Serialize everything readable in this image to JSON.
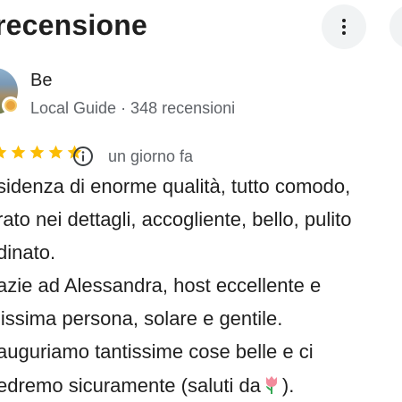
{
  "header": {
    "title": "recensione",
    "more_icon": "more-vert-icon"
  },
  "reviewer": {
    "name": "Be",
    "meta": "Local Guide · 348 recensioni",
    "badge_icon": "local-guide-badge-icon"
  },
  "review": {
    "rating": 5,
    "rating_max": 5,
    "star_color": "#fbbc04",
    "time": "un giorno fa",
    "info_icon": "info-icon",
    "lines": [
      "sidenza di enorme qualità, tutto comodo,",
      "rato nei dettagli, accogliente, bello, pulito",
      "dinato.",
      "azie ad Alessandra, host eccellente e",
      "lissima persona, solare e gentile.",
      "auguriamo tantissime cose belle e ci",
      "edremo sicuramente (saluti da",
      ")."
    ],
    "emoji": "tulip-icon"
  },
  "colors": {
    "title": "#1f1f1f",
    "secondary_text": "#5f6368",
    "button_bg": "#f1f3f4"
  }
}
